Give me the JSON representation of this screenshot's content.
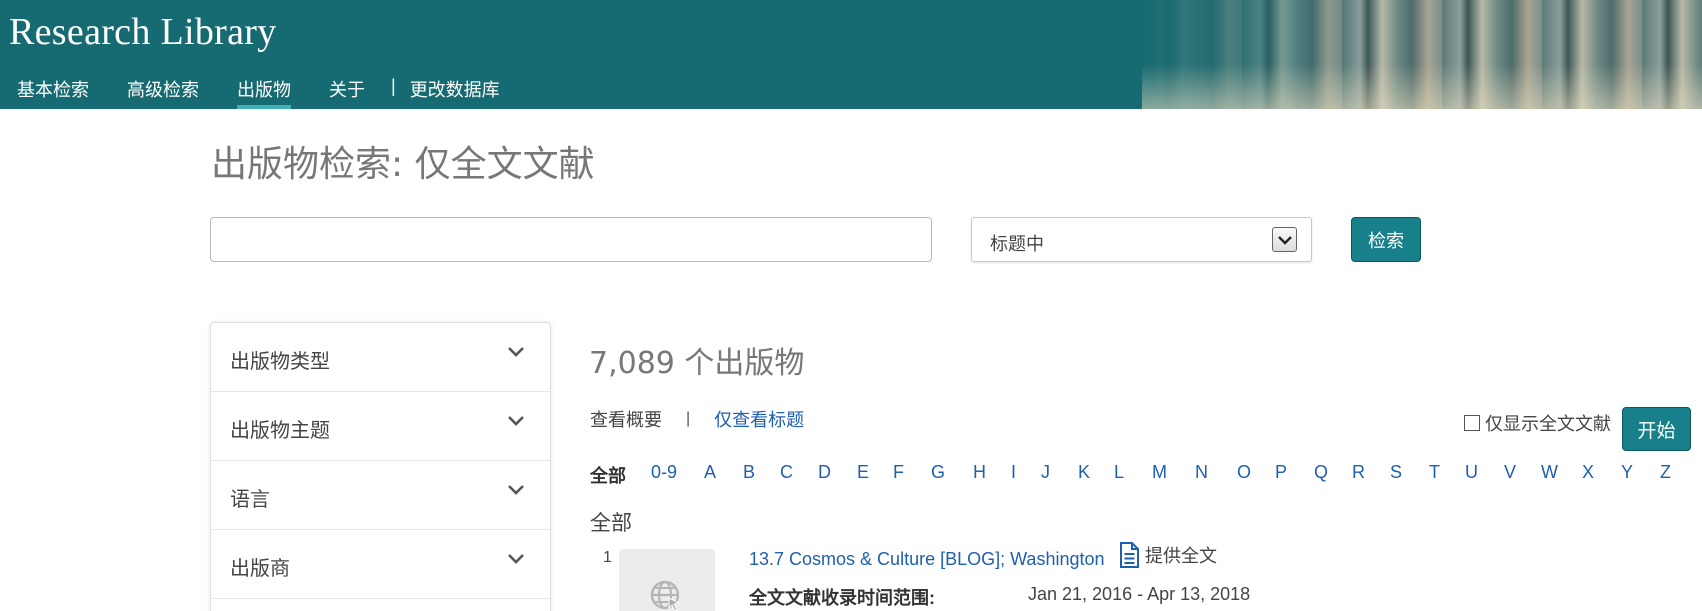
{
  "header": {
    "brand": "Research Library",
    "nav": [
      {
        "label": "基本检索"
      },
      {
        "label": "高级检索"
      },
      {
        "label": "出版物",
        "active": true
      },
      {
        "label": "关于"
      },
      {
        "label": "|"
      },
      {
        "label": "更改数据库"
      }
    ]
  },
  "page": {
    "title": "出版物检索: 仅全文文献"
  },
  "search": {
    "input_value": "",
    "select_value": "标题中",
    "button_label": "检索"
  },
  "facets": [
    {
      "label": "出版物类型"
    },
    {
      "label": "出版物主题"
    },
    {
      "label": "语言"
    },
    {
      "label": "出版商"
    }
  ],
  "results": {
    "count_text": "7,089 个出版物",
    "view_summary": "查看概要",
    "view_separator": "|",
    "view_titles_only": "仅查看标题",
    "fulltext_only_label": "仅显示全文文献",
    "go_button": "开始",
    "alphabet": [
      "全部",
      "0-9",
      "A",
      "B",
      "C",
      "D",
      "E",
      "F",
      "G",
      "H",
      "I",
      "J",
      "K",
      "L",
      "M",
      "N",
      "O",
      "P",
      "Q",
      "R",
      "S",
      "T",
      "U",
      "V",
      "W",
      "X",
      "Y",
      "Z"
    ],
    "section_label": "全部",
    "items": [
      {
        "number": "1",
        "title": "13.7 Cosmos & Culture [BLOG]; Washington",
        "fulltext_badge": "提供全文",
        "coverage_label": "全文文献收录时间范围:",
        "coverage_value": "Jan 21, 2016 - Apr 13, 2018",
        "icon": "globe-icon"
      }
    ]
  },
  "colors": {
    "header_bg": "#166a72",
    "accent_button": "#17808a",
    "link": "#1f5fb0",
    "active_underline": "#3fb1b6"
  }
}
